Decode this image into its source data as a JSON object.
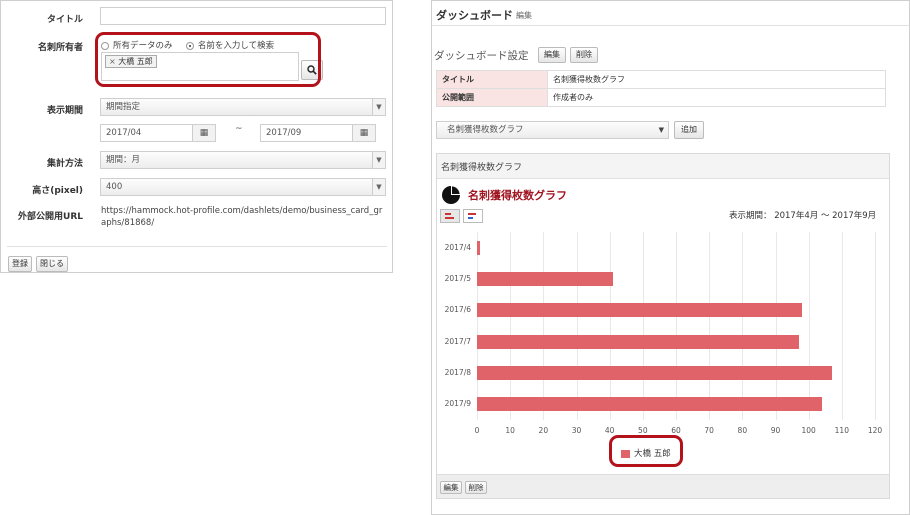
{
  "form": {
    "title_label": "タイトル",
    "title_value": "",
    "owner_label": "名刺所有者",
    "owner_options": [
      "所有データのみ",
      "名前を入力して検索"
    ],
    "owner_selected": "名前を入力して検索",
    "owner_tag": "大橋 五郎",
    "tag_remove": "×",
    "period_label": "表示期間",
    "period_value": "期間指定",
    "date_from": "2017/04",
    "date_sep": "~",
    "date_to": "2017/09",
    "agg_label": "集計方法",
    "agg_value": "期間：月",
    "height_label": "高さ(pixel)",
    "height_value": "400",
    "url_label": "外部公開用URL",
    "url_value": "https://hammock.hot-profile.com/dashlets/demo/business_card_graphs/81868/",
    "register_button": "登録",
    "close_button": "閉じる"
  },
  "dashboard": {
    "title": "ダッシュボード",
    "edit_link": "編集",
    "settings_title": "ダッシュボード設定",
    "settings_edit": "編集",
    "settings_delete": "削除",
    "rows": [
      {
        "key": "タイトル",
        "value": "名刺獲得枚数グラフ"
      },
      {
        "key": "公開範囲",
        "value": "作成者のみ"
      }
    ],
    "graph_select": "名刺獲得枚数グラフ",
    "add_button": "追加",
    "panel_header": "名刺獲得枚数グラフ",
    "chart_title": "名刺獲得枚数グラフ",
    "period_text": "表示期間： 2017年4月 ～ 2017年9月",
    "footer_edit": "編集",
    "footer_delete": "削除"
  },
  "chart_data": {
    "type": "bar",
    "orientation": "horizontal",
    "title": "名刺獲得枚数グラフ",
    "categories": [
      "2017/4",
      "2017/5",
      "2017/6",
      "2017/7",
      "2017/8",
      "2017/9"
    ],
    "series": [
      {
        "name": "大橋 五郎",
        "values": [
          1,
          41,
          98,
          97,
          107,
          104
        ]
      }
    ],
    "xlim": [
      0,
      120
    ],
    "xticks": [
      0,
      10,
      20,
      30,
      40,
      50,
      60,
      70,
      80,
      90,
      100,
      110,
      120
    ],
    "grid": true,
    "legend": "bottom",
    "color": "#e06369"
  },
  "colors": {
    "accent_red": "#b3121a",
    "bar": "#e06369",
    "key_bg": "#f9e3e3"
  }
}
